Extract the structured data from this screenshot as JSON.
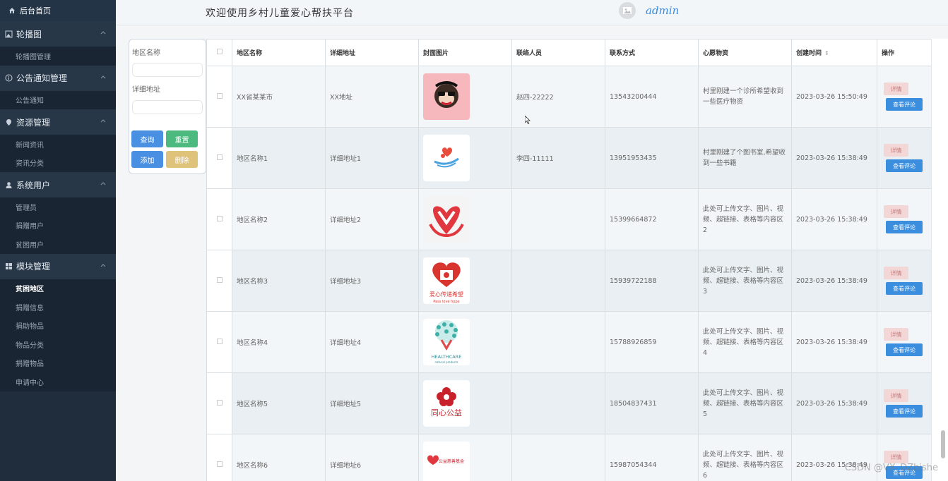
{
  "sidebar": {
    "home": "后台首页",
    "groups": [
      {
        "label": "轮播图",
        "icon": "image-icon",
        "items": [
          "轮播图管理"
        ]
      },
      {
        "label": "公告通知管理",
        "icon": "info-icon",
        "items": [
          "公告通知"
        ]
      },
      {
        "label": "资源管理",
        "icon": "location-pin-icon",
        "items": [
          "新闻资讯",
          "资讯分类"
        ]
      },
      {
        "label": "系统用户",
        "icon": "user-icon",
        "items": [
          "管理员",
          "捐赠用户",
          "贫困用户"
        ]
      },
      {
        "label": "模块管理",
        "icon": "grid-icon",
        "items": [
          "贫困地区",
          "捐赠信息",
          "捐助物品",
          "物品分类",
          "捐赠物品",
          "申请中心"
        ]
      }
    ],
    "active_item": "贫困地区"
  },
  "header": {
    "title": "欢迎使用乡村儿童爱心帮扶平台",
    "username": "admin"
  },
  "search": {
    "region_label": "地区名称",
    "address_label": "详细地址",
    "region_value": "",
    "address_value": "",
    "buttons": {
      "query": "查询",
      "reset": "重置",
      "add": "添加",
      "delete": "删除"
    }
  },
  "colors": {
    "query": "#4a90e2",
    "reset": "#4cba7e",
    "add": "#4a90e2",
    "delete": "#e0c37a",
    "sidebar": "#1f2d3d",
    "comment_btn": "#3b8ede"
  },
  "table": {
    "headers": [
      "地区名称",
      "详细地址",
      "封面图片",
      "联络人员",
      "联系方式",
      "心愿物资",
      "创建时间",
      "操作"
    ],
    "ops": {
      "detail": "详情",
      "comment": "查看评论"
    },
    "rows": [
      {
        "region": "XX省某某市",
        "address": "XX地址",
        "cover": "monkey-logo",
        "contact": "赵四-22222",
        "phone": "13543200444",
        "wish": "村里刚建一个诊所希望收到一些医疗物资",
        "created": "2023-03-26 15:50:49"
      },
      {
        "region": "地区名称1",
        "address": "详细地址1",
        "cover": "hand-heart-logo",
        "contact": "李四-11111",
        "phone": "13951953435",
        "wish": "村里刚建了个图书室,希望收到一些书籍",
        "created": "2023-03-26 15:38:49"
      },
      {
        "region": "地区名称2",
        "address": "详细地址2",
        "cover": "m-hands-logo",
        "contact": "",
        "phone": "15399664872",
        "wish": "此处可上传文字、图片、视频、超链接、表格等内容区2",
        "created": "2023-03-26 15:38:49"
      },
      {
        "region": "地区名称3",
        "address": "详细地址3",
        "cover": "love-pass-logo",
        "contact": "",
        "phone": "15939722188",
        "wish": "此处可上传文字、图片、视频、超链接、表格等内容区3",
        "created": "2023-03-26 15:38:49"
      },
      {
        "region": "地区名称4",
        "address": "详细地址4",
        "cover": "healthcare-logo",
        "contact": "",
        "phone": "15788926859",
        "wish": "此处可上传文字、图片、视频、超链接、表格等内容区4",
        "created": "2023-03-26 15:38:49"
      },
      {
        "region": "地区名称5",
        "address": "详细地址5",
        "cover": "tongxin-logo",
        "contact": "",
        "phone": "18504837431",
        "wish": "此处可上传文字、图片、视频、超链接、表格等内容区5",
        "created": "2023-03-26 15:38:49"
      },
      {
        "region": "地区名称6",
        "address": "详细地址6",
        "cover": "charity-fund-logo",
        "contact": "",
        "phone": "15987054344",
        "wish": "此处可上传文字、图片、视频、超链接、表格等内容区6",
        "created": "2023-03-26 15:38:49"
      }
    ]
  },
  "watermark": "CSDN @VX_DZbishe"
}
